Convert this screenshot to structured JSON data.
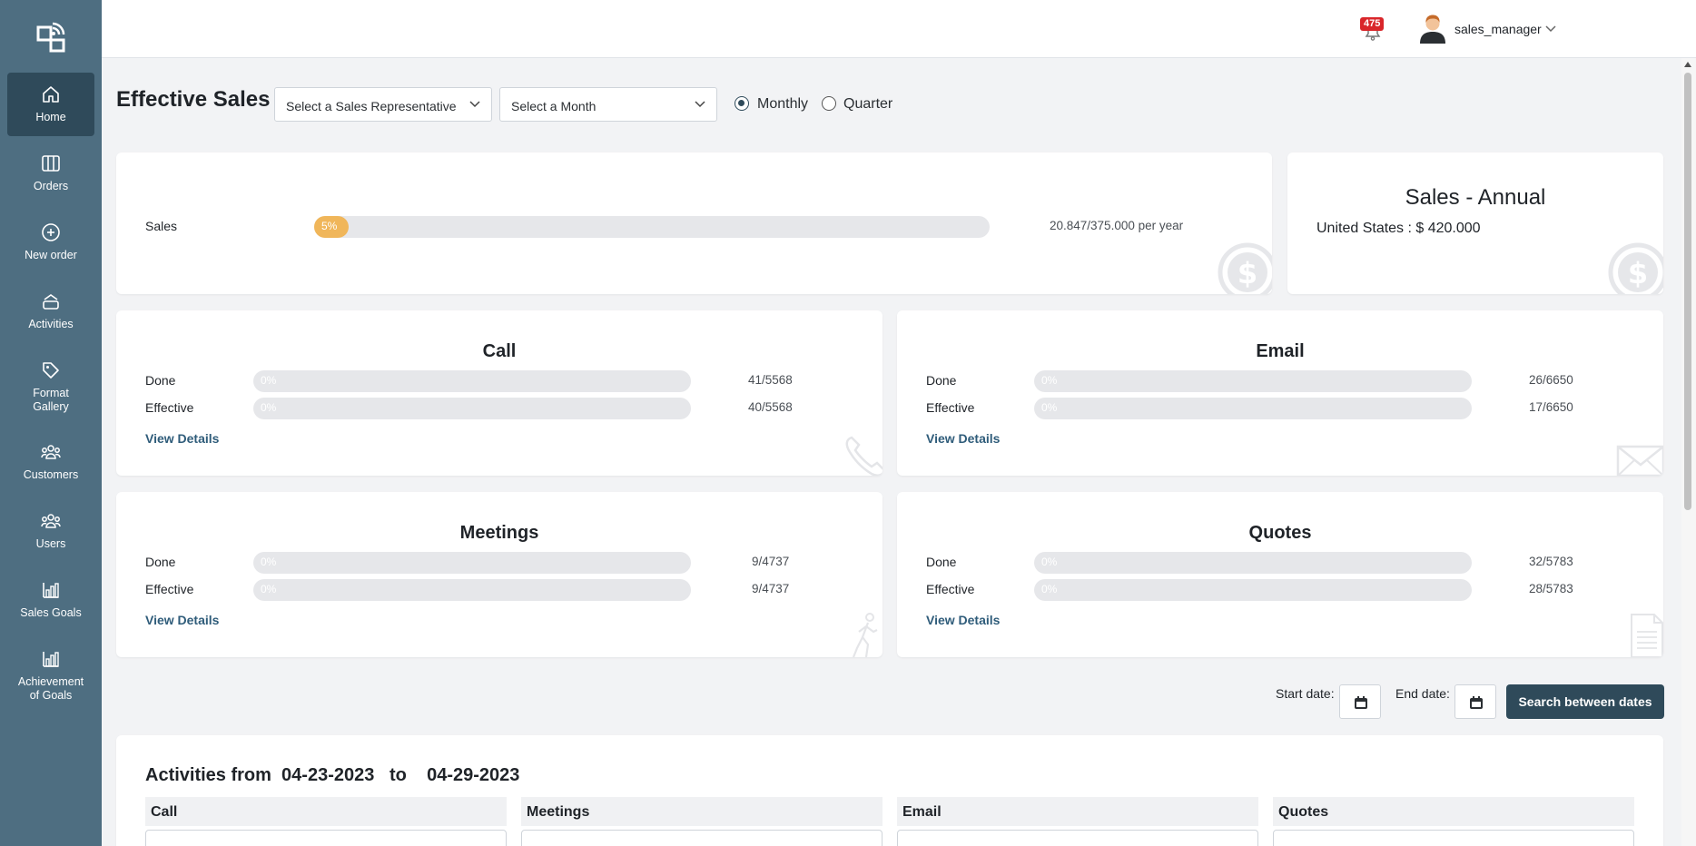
{
  "topbar": {
    "notifications_count": "475",
    "username": "sales_manager"
  },
  "sidebar": {
    "items": [
      {
        "label": "Home",
        "icon": "home-icon"
      },
      {
        "label": "Orders",
        "icon": "columns-icon"
      },
      {
        "label": "New order",
        "icon": "plus-circle-icon"
      },
      {
        "label": "Activities",
        "icon": "layers-icon"
      },
      {
        "label": "Format Gallery",
        "icon": "tag-icon"
      },
      {
        "label": "Customers",
        "icon": "group-icon"
      },
      {
        "label": "Users",
        "icon": "users-icon"
      },
      {
        "label": "Sales Goals",
        "icon": "bar-chart-icon"
      },
      {
        "label": "Achievement of Goals",
        "icon": "bar-chart-icon"
      }
    ],
    "active": "Home"
  },
  "header": {
    "title": "Effective Sales",
    "rep_select_placeholder": "Select a Sales Representative",
    "month_select_placeholder": "Select a Month",
    "period_options": [
      "Monthly",
      "Quarter"
    ],
    "period_selected": "Monthly"
  },
  "sales": {
    "label": "Sales",
    "percent_label": "5%",
    "percent": 5,
    "value": "20.847/375.000 per year"
  },
  "annual": {
    "title": "Sales - Annual",
    "text": "United States : $ 420.000"
  },
  "activity_cards": [
    {
      "title": "Call",
      "done_label": "Done",
      "done_pct": "0%",
      "done_value": "41/5568",
      "effective_label": "Effective",
      "effective_pct": "0%",
      "effective_value": "40/5568",
      "link": "View Details",
      "icon": "phone-icon"
    },
    {
      "title": "Email",
      "done_label": "Done",
      "done_pct": "0%",
      "done_value": "26/6650",
      "effective_label": "Effective",
      "effective_pct": "0%",
      "effective_value": "17/6650",
      "link": "View Details",
      "icon": "envelope-icon"
    },
    {
      "title": "Meetings",
      "done_label": "Done",
      "done_pct": "0%",
      "done_value": "9/4737",
      "effective_label": "Effective",
      "effective_pct": "0%",
      "effective_value": "9/4737",
      "link": "View Details",
      "icon": "walking-person-icon"
    },
    {
      "title": "Quotes",
      "done_label": "Done",
      "done_pct": "0%",
      "done_value": "32/5783",
      "effective_label": "Effective",
      "effective_pct": "0%",
      "effective_value": "28/5783",
      "link": "View Details",
      "icon": "document-icon"
    }
  ],
  "date_search": {
    "start_label": "Start date:",
    "end_label": "End date:",
    "button_label": "Search between dates"
  },
  "activities": {
    "title": "Activities from  04-23-2023   to    04-29-2023",
    "columns": [
      "Call",
      "Meetings",
      "Email",
      "Quotes"
    ]
  },
  "colors": {
    "sidebar": "#4e6e81",
    "sidebar_active": "#2f4a5a",
    "progress_fill": "#f0b65a",
    "primary_button": "#2f4a5a",
    "badge": "#d9262a"
  }
}
